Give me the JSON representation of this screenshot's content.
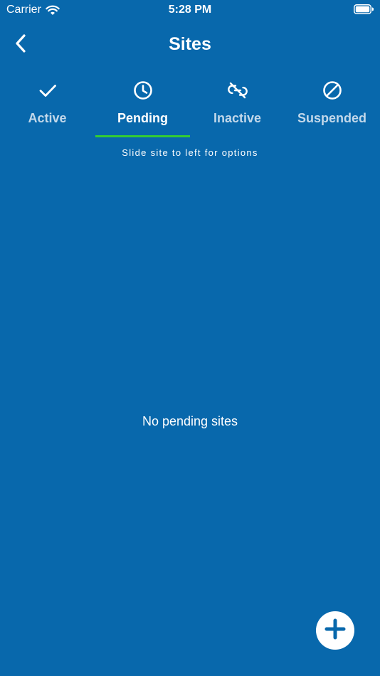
{
  "status_bar": {
    "carrier": "Carrier",
    "time": "5:28 PM",
    "wifi_icon": "wifi-icon",
    "battery_icon": "battery-full-icon"
  },
  "nav": {
    "title": "Sites",
    "back_icon": "chevron-left-icon"
  },
  "tabs": [
    {
      "label": "Active",
      "icon": "checkmark-icon",
      "selected": false
    },
    {
      "label": "Pending",
      "icon": "clock-icon",
      "selected": true
    },
    {
      "label": "Inactive",
      "icon": "broken-link-icon",
      "selected": false
    },
    {
      "label": "Suspended",
      "icon": "prohibited-icon",
      "selected": false
    }
  ],
  "hint": "Slide site to left for options",
  "empty_message": "No pending sites",
  "fab": {
    "icon": "plus-icon"
  },
  "colors": {
    "background": "#0868ac",
    "tab_indicator": "#33cc33",
    "inactive_tab_label": "#c2d8ea",
    "fab_background": "#ffffff",
    "fab_icon": "#0868ac"
  }
}
